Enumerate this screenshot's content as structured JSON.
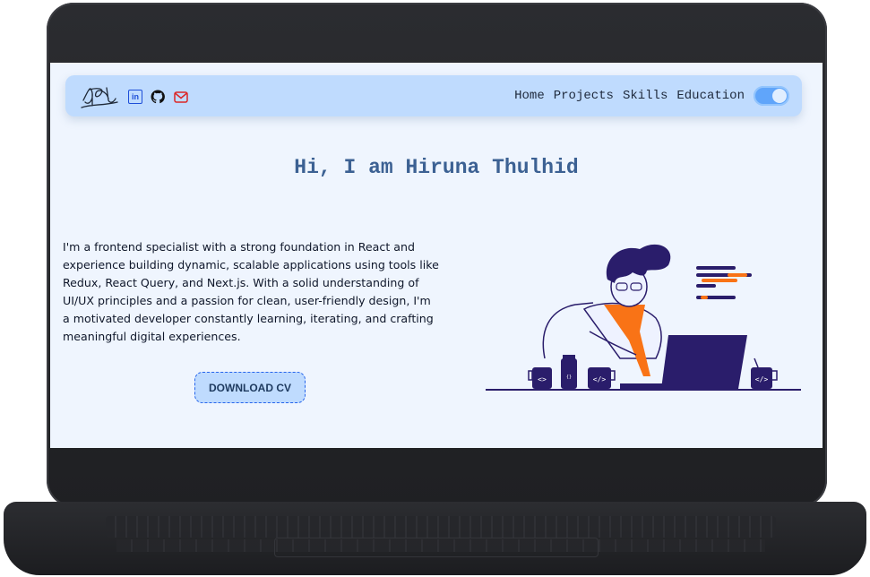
{
  "navbar": {
    "social": [
      "linkedin-icon",
      "github-icon",
      "mail-icon"
    ],
    "links": [
      "Home",
      "Projects",
      "Skills",
      "Education"
    ]
  },
  "hero": {
    "title": "Hi, I am Hiruna Thulhid",
    "intro": "I'm a frontend specialist with a strong foundation in React and experience building dynamic, scalable applications using tools like Redux, React Query, and Next.js. With a solid understanding of UI/UX principles and a passion for clean, user-friendly design, I'm a motivated developer constantly learning, iterating, and crafting meaningful digital experiences.",
    "cv_button": "DOWNLOAD CV"
  },
  "colors": {
    "background": "#eff5fe",
    "navbar": "#bfdbfe",
    "title": "#3c6193",
    "illustration_primary": "#2a1d6b",
    "illustration_accent": "#f97316"
  }
}
